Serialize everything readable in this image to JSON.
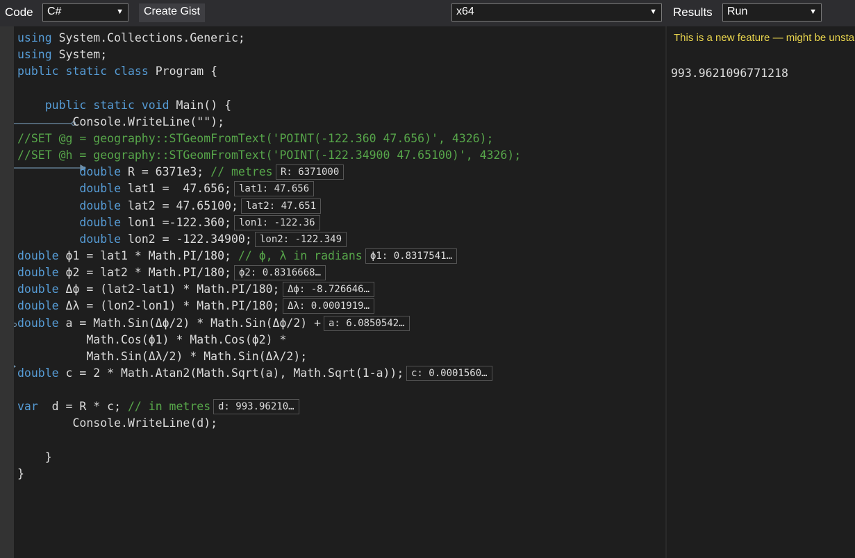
{
  "toolbar": {
    "code_label": "Code",
    "language": "C#",
    "create_gist_label": "Create Gist",
    "platform": "x64",
    "results_label": "Results",
    "run_mode": "Run"
  },
  "code_lines": [
    [
      {
        "t": "using",
        "c": "kw"
      },
      {
        "t": " System.Collections.Generic;",
        "c": "tx"
      }
    ],
    [
      {
        "t": "using",
        "c": "kw"
      },
      {
        "t": " System;",
        "c": "tx"
      }
    ],
    [
      {
        "t": "public",
        "c": "kw"
      },
      {
        "t": " ",
        "c": "tx"
      },
      {
        "t": "static",
        "c": "kw"
      },
      {
        "t": " ",
        "c": "tx"
      },
      {
        "t": "class",
        "c": "kw"
      },
      {
        "t": " Program {",
        "c": "tx"
      }
    ],
    [],
    [
      {
        "t": "    ",
        "c": "tx"
      },
      {
        "t": "public",
        "c": "kw"
      },
      {
        "t": " ",
        "c": "tx"
      },
      {
        "t": "static",
        "c": "kw"
      },
      {
        "t": " ",
        "c": "tx"
      },
      {
        "t": "void",
        "c": "kw"
      },
      {
        "t": " Main() {",
        "c": "tx"
      }
    ],
    [
      {
        "t": "        Console.WriteLine(\"\");",
        "c": "tx"
      }
    ],
    [
      {
        "t": "//SET @g = geography::STGeomFromText('POINT(-122.360 47.656)', 4326);",
        "c": "cm"
      }
    ],
    [
      {
        "t": "//SET @h = geography::STGeomFromText('POINT(-122.34900 47.65100)', 4326);",
        "c": "cm"
      }
    ],
    [
      {
        "t": "         ",
        "c": "tx"
      },
      {
        "t": "double",
        "c": "kw"
      },
      {
        "t": " R = 6371e3; ",
        "c": "tx"
      },
      {
        "t": "// metres",
        "c": "cm"
      }
    ],
    [
      {
        "t": "         ",
        "c": "tx"
      },
      {
        "t": "double",
        "c": "kw"
      },
      {
        "t": " lat1 =  47.656;",
        "c": "tx"
      }
    ],
    [
      {
        "t": "         ",
        "c": "tx"
      },
      {
        "t": "double",
        "c": "kw"
      },
      {
        "t": " lat2 = 47.65100;",
        "c": "tx"
      }
    ],
    [
      {
        "t": "         ",
        "c": "tx"
      },
      {
        "t": "double",
        "c": "kw"
      },
      {
        "t": " lon1 =-122.360;",
        "c": "tx"
      }
    ],
    [
      {
        "t": "         ",
        "c": "tx"
      },
      {
        "t": "double",
        "c": "kw"
      },
      {
        "t": " lon2 = -122.34900;",
        "c": "tx"
      }
    ],
    [
      {
        "t": "double",
        "c": "kw"
      },
      {
        "t": " ϕ1 = lat1 * Math.PI/180; ",
        "c": "tx"
      },
      {
        "t": "// ϕ, λ in radians",
        "c": "cm"
      }
    ],
    [
      {
        "t": "double",
        "c": "kw"
      },
      {
        "t": " ϕ2 = lat2 * Math.PI/180;",
        "c": "tx"
      }
    ],
    [
      {
        "t": "double",
        "c": "kw"
      },
      {
        "t": " Δϕ = (lat2-lat1) * Math.PI/180;",
        "c": "tx"
      }
    ],
    [
      {
        "t": "double",
        "c": "kw"
      },
      {
        "t": " Δλ = (lon2-lon1) * Math.PI/180;",
        "c": "tx"
      }
    ],
    [
      {
        "t": "double",
        "c": "kw"
      },
      {
        "t": " a = Math.Sin(Δϕ/2) * Math.Sin(Δϕ/2) +",
        "c": "tx"
      }
    ],
    [
      {
        "t": "          Math.Cos(ϕ1) * Math.Cos(ϕ2) *",
        "c": "tx"
      }
    ],
    [
      {
        "t": "          Math.Sin(Δλ/2) * Math.Sin(Δλ/2);",
        "c": "tx"
      }
    ],
    [
      {
        "t": "double",
        "c": "kw"
      },
      {
        "t": " c = 2 * Math.Atan2(Math.Sqrt(a), Math.Sqrt(1-a));",
        "c": "tx"
      }
    ],
    [],
    [
      {
        "t": "var",
        "c": "kw"
      },
      {
        "t": "  d = R * c; ",
        "c": "tx"
      },
      {
        "t": "// in metres",
        "c": "cm"
      }
    ],
    [
      {
        "t": "        Console.WriteLine(d);",
        "c": "tx"
      }
    ],
    [],
    [
      {
        "t": "    }",
        "c": "tx"
      }
    ],
    [
      {
        "t": "}",
        "c": "tx"
      }
    ]
  ],
  "inspections": [
    {
      "line": 8,
      "text": "R: 6371000"
    },
    {
      "line": 9,
      "text": "lat1: 47.656"
    },
    {
      "line": 10,
      "text": "lat2: 47.651"
    },
    {
      "line": 11,
      "text": "lon1: -122.36"
    },
    {
      "line": 12,
      "text": "lon2: -122.349"
    },
    {
      "line": 13,
      "text": "ϕ1: 0.8317541…"
    },
    {
      "line": 14,
      "text": "ϕ2: 0.8316668…"
    },
    {
      "line": 15,
      "text": "Δϕ: -8.726646…"
    },
    {
      "line": 16,
      "text": "Δλ: 0.0001919…"
    },
    {
      "line": 17,
      "text": "a: 6.0850542…"
    },
    {
      "line": 20,
      "text": "c: 0.0001560…"
    },
    {
      "line": 22,
      "text": "d: 993.96210…"
    }
  ],
  "results": {
    "notice": "This is a new feature — might be unstable",
    "output": "993.9621096771218"
  },
  "colors": {
    "keyword": "#569cd6",
    "text": "#dcdcdc",
    "comment": "#57a64a",
    "notice": "#e8d44d",
    "flow_arrow": "#6f8fa8"
  }
}
